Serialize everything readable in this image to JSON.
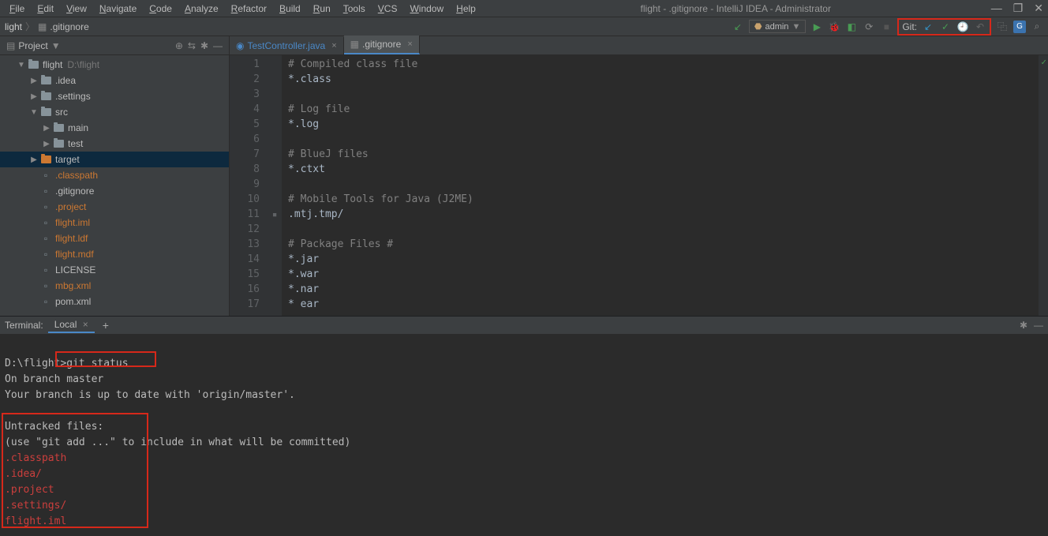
{
  "menu": [
    "File",
    "Edit",
    "View",
    "Navigate",
    "Code",
    "Analyze",
    "Refactor",
    "Build",
    "Run",
    "Tools",
    "VCS",
    "Window",
    "Help"
  ],
  "window_title": "flight - .gitignore - IntelliJ IDEA - Administrator",
  "breadcrumb": {
    "project": "light",
    "file": ".gitignore"
  },
  "run_config": "admin",
  "git_label": "Git:",
  "project": {
    "title": "Project",
    "root": "flight",
    "root_path": "D:\\flight",
    "nodes": [
      {
        "indent": 1,
        "arrow": "down",
        "icon": "folder",
        "label": "flight",
        "trail": "D:\\flight",
        "cls": ""
      },
      {
        "indent": 2,
        "arrow": "right",
        "icon": "folder",
        "label": ".idea",
        "cls": ""
      },
      {
        "indent": 2,
        "arrow": "right",
        "icon": "folder",
        "label": ".settings",
        "cls": ""
      },
      {
        "indent": 2,
        "arrow": "down",
        "icon": "folder",
        "label": "src",
        "cls": ""
      },
      {
        "indent": 3,
        "arrow": "right",
        "icon": "folder",
        "label": "main",
        "cls": ""
      },
      {
        "indent": 3,
        "arrow": "right",
        "icon": "folder",
        "label": "test",
        "cls": ""
      },
      {
        "indent": 2,
        "arrow": "right",
        "icon": "folder-orange",
        "label": "target",
        "cls": "",
        "sel": true
      },
      {
        "indent": 2,
        "arrow": "",
        "icon": "file",
        "label": ".classpath",
        "cls": "orange"
      },
      {
        "indent": 2,
        "arrow": "",
        "icon": "file",
        "label": ".gitignore",
        "cls": ""
      },
      {
        "indent": 2,
        "arrow": "",
        "icon": "file",
        "label": ".project",
        "cls": "orange"
      },
      {
        "indent": 2,
        "arrow": "",
        "icon": "file",
        "label": "flight.iml",
        "cls": "orange"
      },
      {
        "indent": 2,
        "arrow": "",
        "icon": "file",
        "label": "flight.ldf",
        "cls": "orange"
      },
      {
        "indent": 2,
        "arrow": "",
        "icon": "file",
        "label": "flight.mdf",
        "cls": "orange"
      },
      {
        "indent": 2,
        "arrow": "",
        "icon": "file",
        "label": "LICENSE",
        "cls": ""
      },
      {
        "indent": 2,
        "arrow": "",
        "icon": "file",
        "label": "mbg.xml",
        "cls": "orange"
      },
      {
        "indent": 2,
        "arrow": "",
        "icon": "file",
        "label": "pom.xml",
        "cls": ""
      }
    ]
  },
  "tabs": [
    {
      "label": "TestController.java",
      "cls": "blue",
      "active": false
    },
    {
      "label": ".gitignore",
      "cls": "",
      "active": true
    }
  ],
  "editor_lines": [
    {
      "n": 1,
      "t": "# Compiled class file",
      "c": true
    },
    {
      "n": 2,
      "t": "*.class",
      "c": false
    },
    {
      "n": 3,
      "t": "",
      "c": false
    },
    {
      "n": 4,
      "t": "# Log file",
      "c": true
    },
    {
      "n": 5,
      "t": "*.log",
      "c": false
    },
    {
      "n": 6,
      "t": "",
      "c": false
    },
    {
      "n": 7,
      "t": "# BlueJ files",
      "c": true
    },
    {
      "n": 8,
      "t": "*.ctxt",
      "c": false
    },
    {
      "n": 9,
      "t": "",
      "c": false
    },
    {
      "n": 10,
      "t": "# Mobile Tools for Java (J2ME)",
      "c": true
    },
    {
      "n": 11,
      "t": ".mtj.tmp/",
      "c": false,
      "fold": true
    },
    {
      "n": 12,
      "t": "",
      "c": false
    },
    {
      "n": 13,
      "t": "# Package Files #",
      "c": true
    },
    {
      "n": 14,
      "t": "*.jar",
      "c": false
    },
    {
      "n": 15,
      "t": "*.war",
      "c": false
    },
    {
      "n": 16,
      "t": "*.nar",
      "c": false
    },
    {
      "n": 17,
      "t": "* ear",
      "c": false
    }
  ],
  "terminal": {
    "header": "Terminal:",
    "tab": "Local",
    "prompt_path": "D:\\flight>",
    "command": "git status",
    "lines": [
      {
        "t": "On branch master",
        "cls": ""
      },
      {
        "t": "Your branch is up to date with 'origin/master'.",
        "cls": ""
      },
      {
        "t": "",
        "cls": ""
      },
      {
        "t": "Untracked files:",
        "cls": ""
      },
      {
        "t": "  (use \"git add <file>...\" to include in what will be committed)",
        "cls": ""
      },
      {
        "t": "        .classpath",
        "cls": "red"
      },
      {
        "t": "        .idea/",
        "cls": "red"
      },
      {
        "t": "        .project",
        "cls": "red"
      },
      {
        "t": "        .settings/",
        "cls": "red"
      },
      {
        "t": "        flight.iml",
        "cls": "red"
      }
    ]
  }
}
